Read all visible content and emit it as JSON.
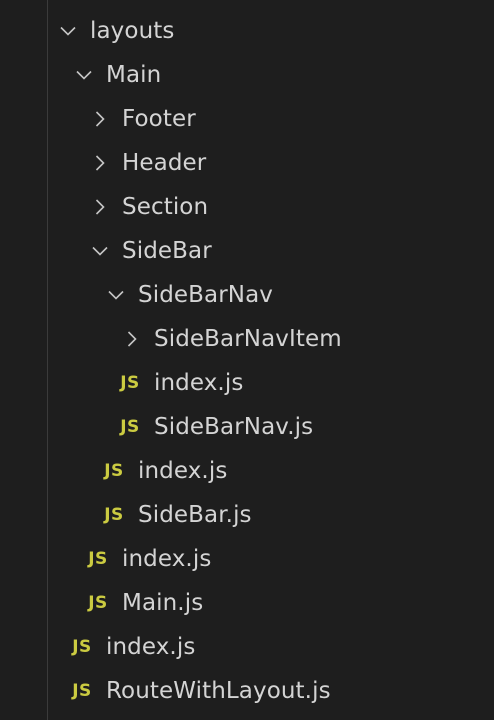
{
  "explorer": {
    "tree": [
      {
        "label": "layouts",
        "kind": "folder",
        "expanded": true,
        "icon": "chevron-down-icon"
      },
      {
        "label": "Main",
        "kind": "folder",
        "expanded": true,
        "icon": "chevron-down-icon"
      },
      {
        "label": "Footer",
        "kind": "folder",
        "expanded": false,
        "icon": "chevron-right-icon"
      },
      {
        "label": "Header",
        "kind": "folder",
        "expanded": false,
        "icon": "chevron-right-icon"
      },
      {
        "label": "Section",
        "kind": "folder",
        "expanded": false,
        "icon": "chevron-right-icon"
      },
      {
        "label": "SideBar",
        "kind": "folder",
        "expanded": true,
        "icon": "chevron-down-icon"
      },
      {
        "label": "SideBarNav",
        "kind": "folder",
        "expanded": true,
        "icon": "chevron-down-icon"
      },
      {
        "label": "SideBarNavItem",
        "kind": "folder",
        "expanded": false,
        "icon": "chevron-right-icon"
      },
      {
        "label": "index.js",
        "kind": "file",
        "icon": "js-file-icon",
        "badge": "JS"
      },
      {
        "label": "SideBarNav.js",
        "kind": "file",
        "icon": "js-file-icon",
        "badge": "JS"
      },
      {
        "label": "index.js",
        "kind": "file",
        "icon": "js-file-icon",
        "badge": "JS"
      },
      {
        "label": "SideBar.js",
        "kind": "file",
        "icon": "js-file-icon",
        "badge": "JS"
      },
      {
        "label": "index.js",
        "kind": "file",
        "icon": "js-file-icon",
        "badge": "JS"
      },
      {
        "label": "Main.js",
        "kind": "file",
        "icon": "js-file-icon",
        "badge": "JS"
      },
      {
        "label": "index.js",
        "kind": "file",
        "icon": "js-file-icon",
        "badge": "JS"
      },
      {
        "label": "RouteWithLayout.js",
        "kind": "file",
        "icon": "js-file-icon",
        "badge": "JS"
      }
    ]
  },
  "colors": {
    "background": "#1e1e1e",
    "text": "#d4d4d4",
    "js_badge": "#cbcb41",
    "indent_guide": "#3b3b3b"
  }
}
